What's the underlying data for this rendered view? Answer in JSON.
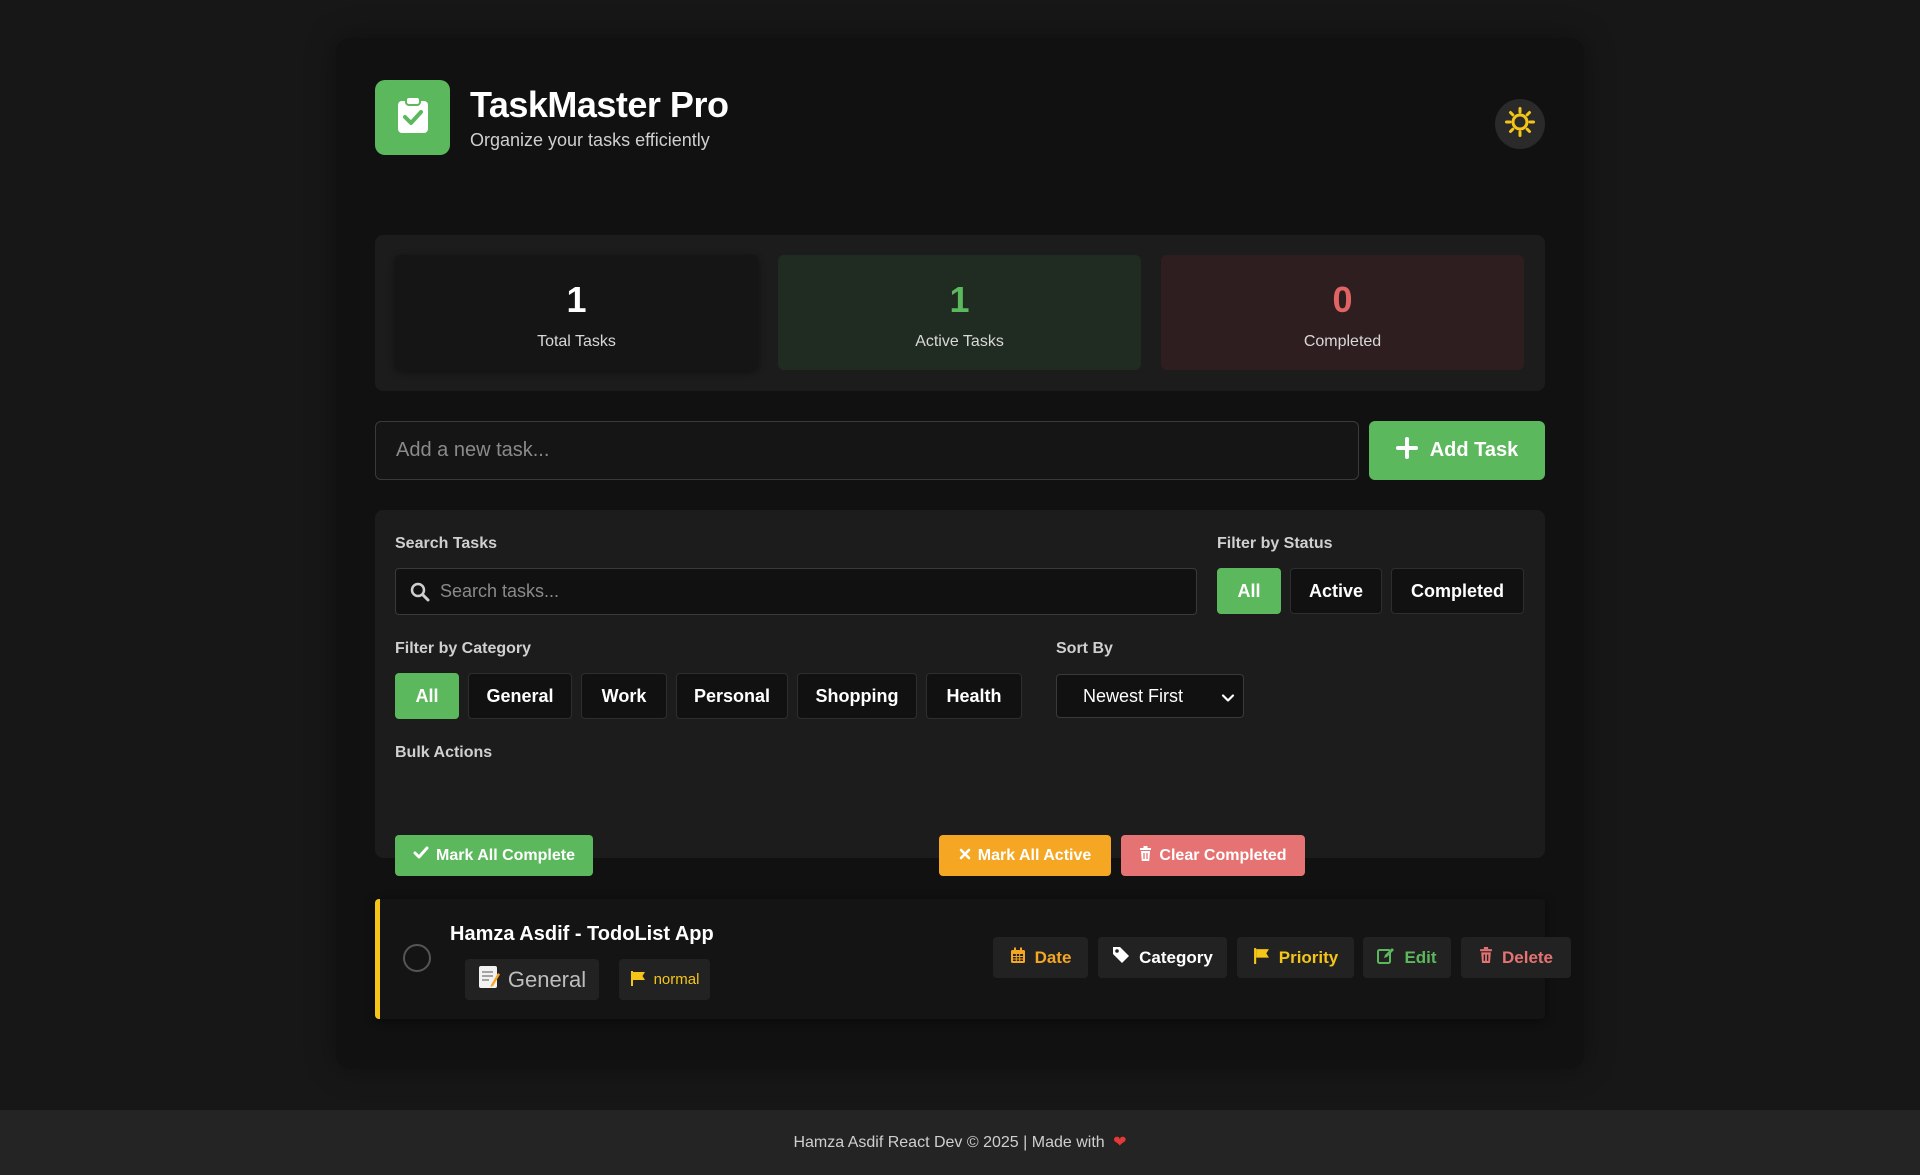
{
  "header": {
    "title": "TaskMaster Pro",
    "subtitle": "Organize your tasks efficiently",
    "logo_icon": "clipboard-check-icon",
    "theme_icon": "sun-icon"
  },
  "stats": {
    "total": {
      "value": "1",
      "label": "Total Tasks"
    },
    "active": {
      "value": "1",
      "label": "Active Tasks"
    },
    "completed": {
      "value": "0",
      "label": "Completed"
    }
  },
  "add_task": {
    "placeholder": "Add a new task...",
    "button_label": "Add Task"
  },
  "filters": {
    "search_label": "Search Tasks",
    "search_placeholder": "Search tasks...",
    "status_label": "Filter by Status",
    "status_options": [
      "All",
      "Active",
      "Completed"
    ],
    "status_selected": "All",
    "category_label": "Filter by Category",
    "category_options": [
      "All",
      "General",
      "Work",
      "Personal",
      "Shopping",
      "Health"
    ],
    "category_selected": "All",
    "sort_label": "Sort By",
    "sort_value": "Newest First",
    "bulk_label": "Bulk Actions",
    "bulk_actions": {
      "mark_all_complete": "Mark All Complete",
      "mark_all_active": "Mark All Active",
      "clear_completed": "Clear Completed"
    }
  },
  "tasks": [
    {
      "title": "Hamza Asdif - TodoList App",
      "category": "General",
      "category_icon": "memo-icon",
      "priority": "normal",
      "priority_color": "#f5c518",
      "completed": false,
      "actions": {
        "date": "Date",
        "category": "Category",
        "priority": "Priority",
        "edit": "Edit",
        "delete": "Delete"
      }
    }
  ],
  "footer": {
    "text": "Hamza Asdif React Dev © 2025 | Made with",
    "heart": "❤"
  },
  "colors": {
    "accent_green": "#5cb85c",
    "warning_orange": "#f5a623",
    "danger_red": "#e57373",
    "priority_yellow": "#f5c518"
  }
}
